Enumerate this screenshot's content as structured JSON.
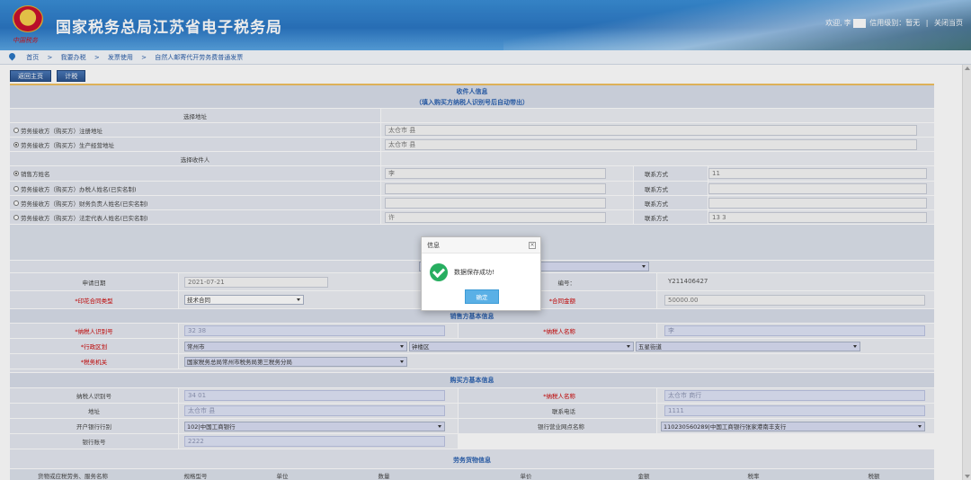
{
  "header": {
    "title": "国家税务总局江苏省电子税务局",
    "emblem_text": "中国税务",
    "welcome": "欢迎,",
    "user_initial": "李",
    "credit_label": "信用级别：暂无",
    "separator": "|",
    "close_label": "关闭当页"
  },
  "breadcrumb": [
    "首页",
    "我要办税",
    "发票使用",
    "自然人邮寄代开劳务费普通发票"
  ],
  "breadcrumb_sep": ">",
  "toolbar": {
    "back": "返回主页",
    "calc": "计税"
  },
  "receiver": {
    "title": "收件人信息",
    "subtitle": "（填入购买方纳税人识别号后自动带出）",
    "choose_address": "选择地址",
    "addr1_label": "劳务接收方（购买方）注册地址",
    "addr1_value": "太仓市                    县",
    "addr2_label": "劳务接收方（购买方）生产经营地址",
    "addr2_value": "太仓市                    县",
    "choose_recipient": "选择收件人",
    "r1_label": "销售方姓名",
    "r1_value": "李",
    "r2_label": "劳务接收方（购买方）办税人姓名(已实名制)",
    "r3_label": "劳务接收方（购买方）财务负责人姓名(已实名制)",
    "r4_label": "劳务接收方（购买方）法定代表人姓名(已实名制)",
    "r4_value": "许",
    "contact_label": "联系方式",
    "contact1": "11",
    "contact4": "13                  3"
  },
  "apply": {
    "date_label": "申请日期",
    "date_value": "2021-07-21",
    "no_label": "编号：",
    "no_value": "Y211406427",
    "contract_label": "*印花合同类型",
    "contract_value": "技术合同",
    "amount_label": "*合同金额",
    "amount_value": "50000.00"
  },
  "seller": {
    "title": "销售方基本信息",
    "tax_id_label": "*纳税人识别号",
    "tax_id_value": "32                      38",
    "name_label": "*纳税人名称",
    "name_value": "李",
    "region_label": "*行政区划",
    "region_city": "常州市",
    "region_district": "钟楼区",
    "region_street": "五星街道",
    "tax_office_label": "*税务机关",
    "tax_office_value": "国家税务总局常州市税务局第三税务分局"
  },
  "buyer": {
    "title": "购买方基本信息",
    "tax_id_label": "纳税人识别号",
    "tax_id_value": "34                        01",
    "name_label": "*纳税人名称",
    "name_value": "太仓市                        商行",
    "address_label": "地址",
    "address_value": "太仓市            县",
    "phone_label": "联系电话",
    "phone_value": "1111",
    "bank_label": "开户银行行别",
    "bank_value": "102|中国工商银行",
    "branch_label": "银行营业网点名称",
    "branch_value": "110230560289|中国工商银行张家港南丰支行",
    "account_label": "银行账号",
    "account_value": "2222"
  },
  "goods": {
    "title": "劳务货物信息",
    "columns": [
      "货物或应税劳务、服务名称",
      "规格型号",
      "单位",
      "数量",
      "单价",
      "金额",
      "税率",
      "税额"
    ]
  },
  "modal": {
    "title": "信息",
    "close": "×",
    "message": "数据保存成功!",
    "ok": "确定"
  }
}
